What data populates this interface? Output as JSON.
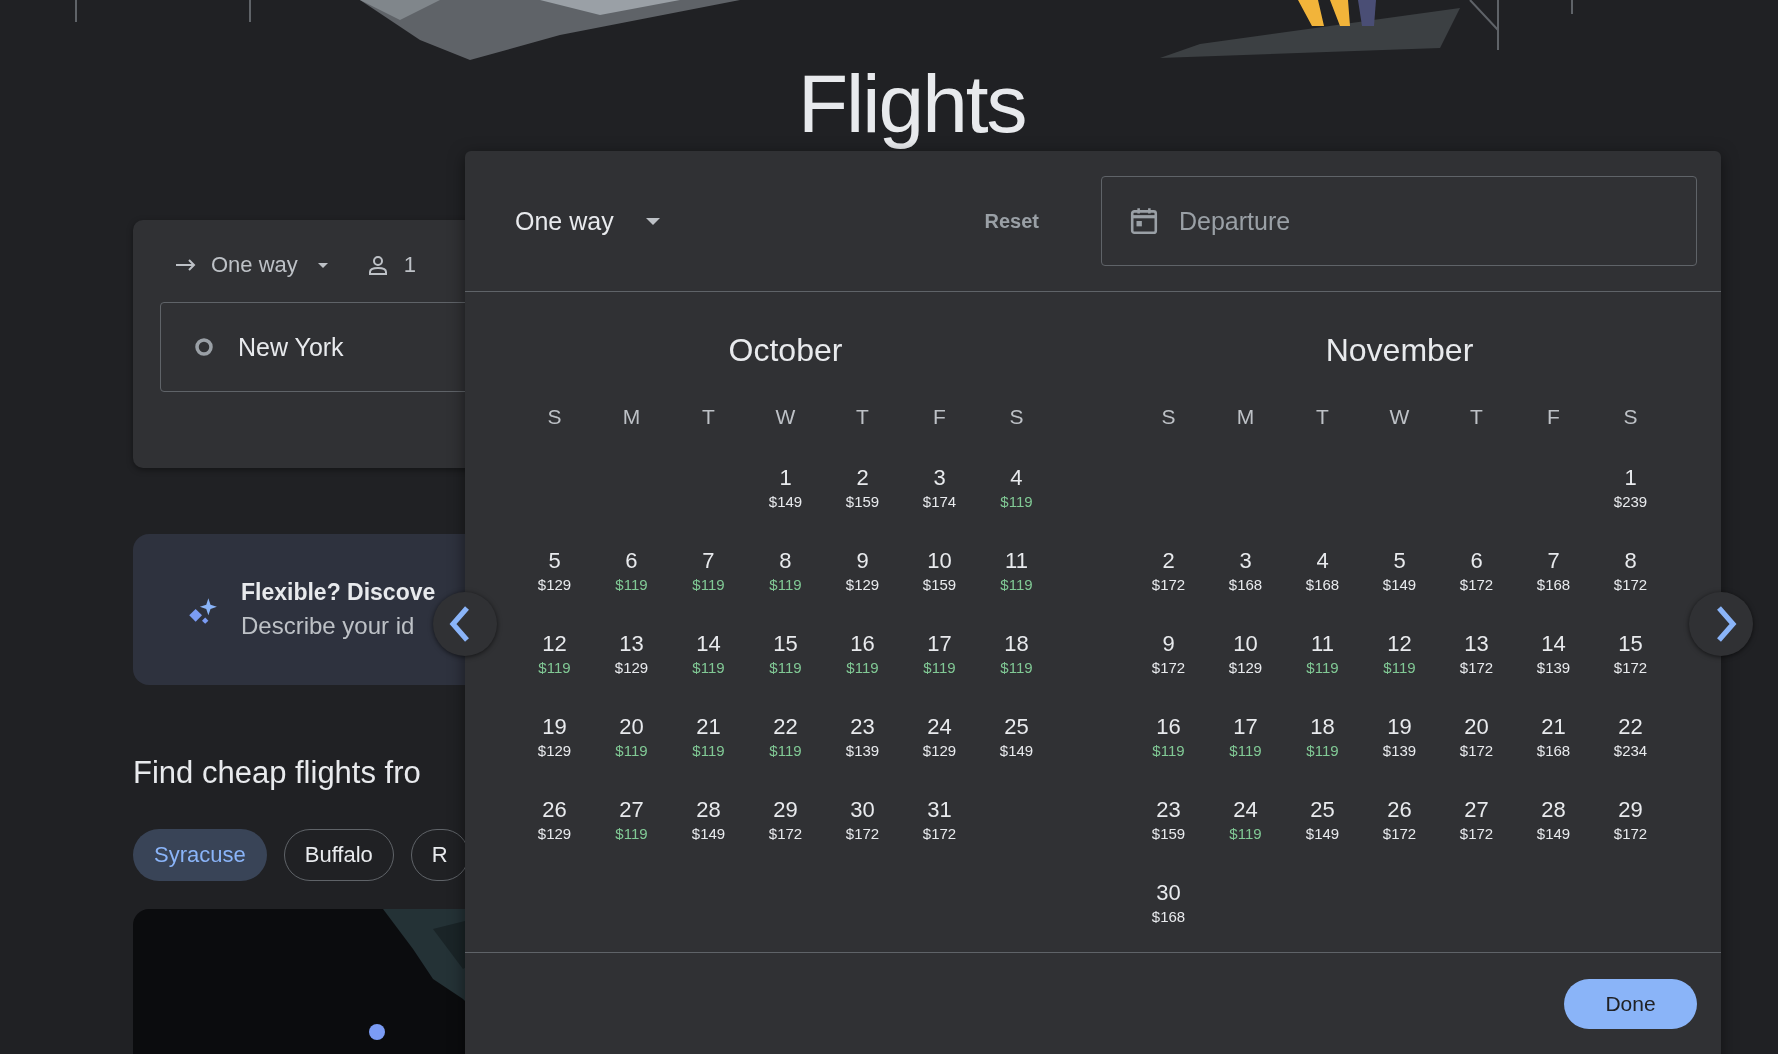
{
  "title": "Flights",
  "search_card": {
    "trip_type": "One way",
    "passengers": "1",
    "origin": "New York"
  },
  "promo": {
    "title": "Flexible? Discove",
    "text": "Describe your id"
  },
  "section_title": "Find cheap flights fro",
  "chips": [
    {
      "label": "Syracuse",
      "selected": true
    },
    {
      "label": "Buffalo",
      "selected": false
    },
    {
      "label": "R",
      "selected": false
    }
  ],
  "date_picker": {
    "trip_type": "One way",
    "reset": "Reset",
    "departure": {
      "placeholder": "Departure"
    },
    "done": "Done",
    "months": [
      {
        "name": "October",
        "weekdays": [
          "S",
          "M",
          "T",
          "W",
          "T",
          "F",
          "S"
        ],
        "weeks": [
          [
            {
              "day": "1",
              "price": "$149",
              "cheap": false
            },
            {
              "day": "2",
              "price": "$159",
              "cheap": false
            },
            {
              "day": "3",
              "price": "$174",
              "cheap": false
            },
            {
              "day": "4",
              "price": "$119",
              "cheap": true
            }
          ],
          [
            {
              "day": "5",
              "price": "$129",
              "cheap": false
            },
            {
              "day": "6",
              "price": "$119",
              "cheap": true
            },
            {
              "day": "7",
              "price": "$119",
              "cheap": true
            },
            {
              "day": "8",
              "price": "$119",
              "cheap": true
            },
            {
              "day": "9",
              "price": "$129",
              "cheap": false
            },
            {
              "day": "10",
              "price": "$159",
              "cheap": false
            },
            {
              "day": "11",
              "price": "$119",
              "cheap": true
            }
          ],
          [
            {
              "day": "12",
              "price": "$119",
              "cheap": true
            },
            {
              "day": "13",
              "price": "$129",
              "cheap": false
            },
            {
              "day": "14",
              "price": "$119",
              "cheap": true
            },
            {
              "day": "15",
              "price": "$119",
              "cheap": true
            },
            {
              "day": "16",
              "price": "$119",
              "cheap": true
            },
            {
              "day": "17",
              "price": "$119",
              "cheap": true
            },
            {
              "day": "18",
              "price": "$119",
              "cheap": true
            }
          ],
          [
            {
              "day": "19",
              "price": "$129",
              "cheap": false
            },
            {
              "day": "20",
              "price": "$119",
              "cheap": true
            },
            {
              "day": "21",
              "price": "$119",
              "cheap": true
            },
            {
              "day": "22",
              "price": "$119",
              "cheap": true
            },
            {
              "day": "23",
              "price": "$139",
              "cheap": false
            },
            {
              "day": "24",
              "price": "$129",
              "cheap": false
            },
            {
              "day": "25",
              "price": "$149",
              "cheap": false
            }
          ],
          [
            {
              "day": "26",
              "price": "$129",
              "cheap": false
            },
            {
              "day": "27",
              "price": "$119",
              "cheap": true
            },
            {
              "day": "28",
              "price": "$149",
              "cheap": false
            },
            {
              "day": "29",
              "price": "$172",
              "cheap": false
            },
            {
              "day": "30",
              "price": "$172",
              "cheap": false
            },
            {
              "day": "31",
              "price": "$172",
              "cheap": false
            }
          ]
        ]
      },
      {
        "name": "November",
        "weekdays": [
          "S",
          "M",
          "T",
          "W",
          "T",
          "F",
          "S"
        ],
        "weeks": [
          [
            {
              "day": "1",
              "price": "$239",
              "cheap": false
            }
          ],
          [
            {
              "day": "2",
              "price": "$172",
              "cheap": false
            },
            {
              "day": "3",
              "price": "$168",
              "cheap": false
            },
            {
              "day": "4",
              "price": "$168",
              "cheap": false
            },
            {
              "day": "5",
              "price": "$149",
              "cheap": false
            },
            {
              "day": "6",
              "price": "$172",
              "cheap": false
            },
            {
              "day": "7",
              "price": "$168",
              "cheap": false
            },
            {
              "day": "8",
              "price": "$172",
              "cheap": false
            }
          ],
          [
            {
              "day": "9",
              "price": "$172",
              "cheap": false
            },
            {
              "day": "10",
              "price": "$129",
              "cheap": false
            },
            {
              "day": "11",
              "price": "$119",
              "cheap": true
            },
            {
              "day": "12",
              "price": "$119",
              "cheap": true
            },
            {
              "day": "13",
              "price": "$172",
              "cheap": false
            },
            {
              "day": "14",
              "price": "$139",
              "cheap": false
            },
            {
              "day": "15",
              "price": "$172",
              "cheap": false
            }
          ],
          [
            {
              "day": "16",
              "price": "$119",
              "cheap": true
            },
            {
              "day": "17",
              "price": "$119",
              "cheap": true
            },
            {
              "day": "18",
              "price": "$119",
              "cheap": true
            },
            {
              "day": "19",
              "price": "$139",
              "cheap": false
            },
            {
              "day": "20",
              "price": "$172",
              "cheap": false
            },
            {
              "day": "21",
              "price": "$168",
              "cheap": false
            },
            {
              "day": "22",
              "price": "$234",
              "cheap": false
            }
          ],
          [
            {
              "day": "23",
              "price": "$159",
              "cheap": false
            },
            {
              "day": "24",
              "price": "$119",
              "cheap": true
            },
            {
              "day": "25",
              "price": "$149",
              "cheap": false
            },
            {
              "day": "26",
              "price": "$172",
              "cheap": false
            },
            {
              "day": "27",
              "price": "$172",
              "cheap": false
            },
            {
              "day": "28",
              "price": "$149",
              "cheap": false
            },
            {
              "day": "29",
              "price": "$172",
              "cheap": false
            }
          ],
          [
            {
              "day": "30",
              "price": "$168",
              "cheap": false
            }
          ]
        ]
      }
    ]
  }
}
